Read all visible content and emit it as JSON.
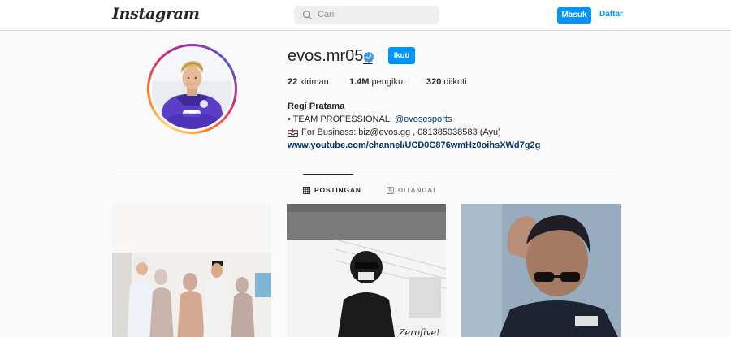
{
  "nav": {
    "logo": "Instagram",
    "search_placeholder": "Cari",
    "login_label": "Masuk",
    "signup_label": "Daftar",
    "accent_color": "#0095f6"
  },
  "profile": {
    "username": "evos.mr05_",
    "verified": true,
    "follow_label": "Ikuti",
    "stats": {
      "posts_count": "22",
      "posts_label": "kiriman",
      "followers_count": "1.4M",
      "followers_label": "pengikut",
      "following_count": "320",
      "following_label": "diikuti"
    },
    "full_name": "Regi Pratama",
    "bio_line1_prefix": "• TEAM PROFESSIONAL: ",
    "bio_line1_mention": "@evosesports",
    "bio_line2": "For Business: biz@evos.gg , 081385038583 (Ayu)",
    "bio_link": "www.youtube.com/channel/UCD0C876wmHz0oihsXWd7g2g"
  },
  "tabs": [
    {
      "label": "POSTINGAN",
      "icon": "grid-icon",
      "active": true
    },
    {
      "label": "DITANDAI",
      "icon": "tagged-icon",
      "active": false
    }
  ],
  "posts": [
    {
      "description_icon": "photo-group"
    },
    {
      "description_icon": "photo-bw",
      "caption": "Zerofive!"
    },
    {
      "description_icon": "photo-face"
    }
  ]
}
